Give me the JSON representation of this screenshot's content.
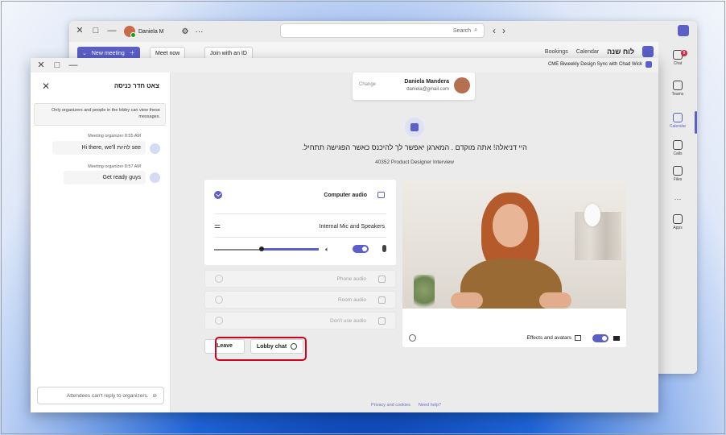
{
  "teams_window": {
    "user_name": "Daniela M",
    "search_placeholder": "Search",
    "more": "···",
    "new_meeting_label": "New meeting",
    "meet_now_label": "Meet now",
    "join_with_id_label": "Join with an ID",
    "calendar_header": "לוח שנה",
    "tab_calendar": "Calendar",
    "tab_bookings": "Bookings",
    "rail": [
      {
        "label": "Chat",
        "badge": "8"
      },
      {
        "label": "Teams"
      },
      {
        "label": "Calendar"
      },
      {
        "label": "Calls"
      },
      {
        "label": "Files"
      },
      {
        "label": "···"
      },
      {
        "label": "Apps"
      }
    ]
  },
  "lobby_window": {
    "title": "CME Biweekly Design Sync with Chad Wick",
    "chat_panel": {
      "title": "צאט חדר כניסה",
      "notice": "Only organizers and people in the lobby can view these messages.",
      "messages": [
        {
          "meta": "Meeting organizer 8:55 AM",
          "text": "Hi there, we'll להיות see"
        },
        {
          "meta": "Meeting organizer 8:57 AM",
          "text": "Get ready guys"
        }
      ],
      "input_status": "Attendees can't reply to organizers."
    },
    "account": {
      "name": "Daniela Mandera",
      "email": "daniela@gmail.com",
      "change_label": "Change"
    },
    "hebrew_message": "היי דניאלה! אתה מוקדם . המארגן יאפשר לך להיכנס כאשר הפגישה תתחיל.",
    "meeting_name": "40352 Product Designer Interview",
    "video": {
      "effects_label": "Effects and avatars"
    },
    "audio": {
      "computer_audio_label": "Computer audio",
      "device_label": "Internal Mic and Speakers",
      "volume_level": 0.55,
      "phone_audio_label": "Phone audio",
      "room_audio_label": "Room audio",
      "dont_use_audio_label": "Don't use audio"
    },
    "leave_label": "Leave",
    "lobby_chat_label": "Lobby chat",
    "need_help": "Need help?",
    "privacy": "Privacy and cookies"
  },
  "colors": {
    "brand": "#5b5fc7",
    "highlight": "#d0021b"
  }
}
